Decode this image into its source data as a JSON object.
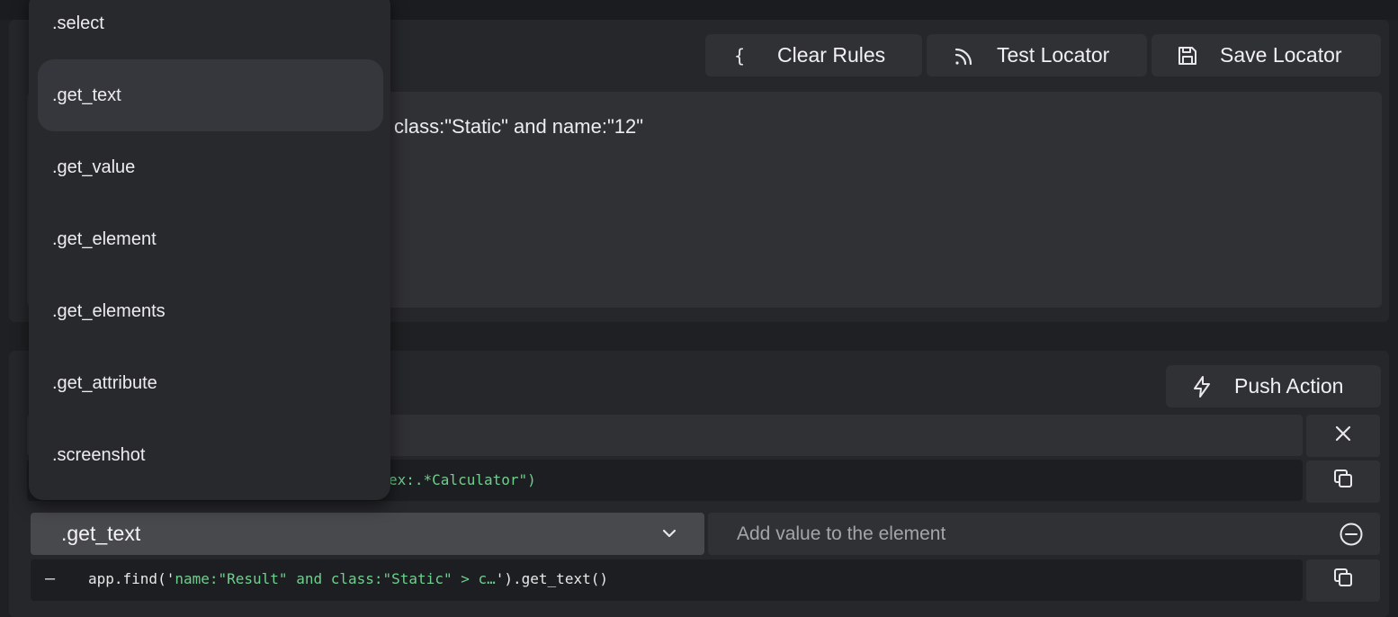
{
  "locator": {
    "buttons": {
      "clear_rules": "Clear Rules",
      "test_locator": "Test Locator",
      "save_locator": "Save Locator"
    },
    "rule_text": "class:\"Static\" and name:\"12\""
  },
  "action": {
    "push_action": "Push Action",
    "find_code_fragment": "ex:.*Calculator\")",
    "method_selected": ".get_text",
    "value_placeholder": "Add value to the element",
    "code_dash": "–",
    "code": {
      "prefix": "app.find('",
      "selector": "name:\"Result\" and class:\"Static\" > c…",
      "suffix": "').get_text()"
    }
  },
  "dropdown": {
    "items": [
      ".select",
      ".get_text",
      ".get_value",
      ".get_element",
      ".get_elements",
      ".get_attribute",
      ".screenshot"
    ],
    "selected": ".get_text"
  },
  "colors": {
    "background": "#1f2023",
    "panel": "#26272b",
    "control": "#303135",
    "code_string": "#6fcf8e"
  },
  "icons": {
    "clear_rules": "braces-icon",
    "test_locator": "rss-signal-icon",
    "save_locator": "floppy-disk-icon",
    "push_action": "lightning-icon",
    "remove_row": "close-icon",
    "copy": "copy-icon",
    "dropdown": "chevron-down-icon",
    "remove_value": "minus-circle-icon"
  }
}
